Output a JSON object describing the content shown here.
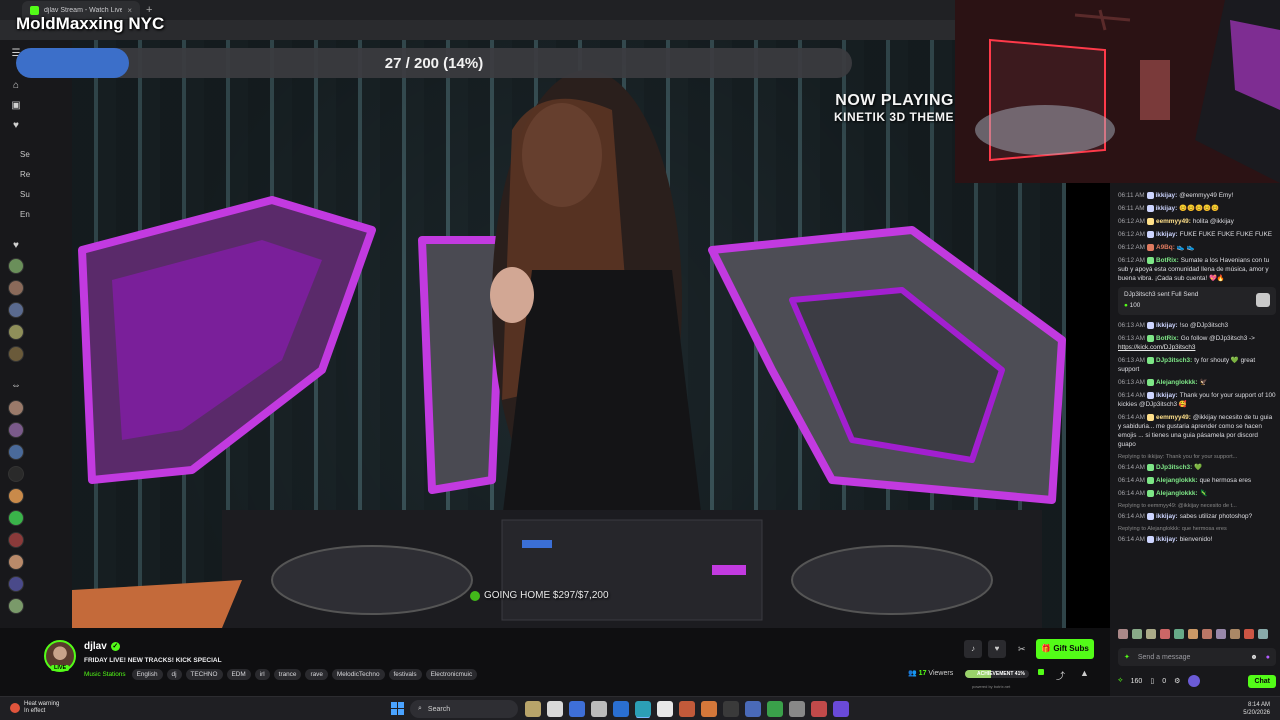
{
  "browser": {
    "tab_title": "djlav Stream - Watch Live on",
    "tab_close": "×",
    "new_tab": "+"
  },
  "overlay": {
    "channel_title": "MoldMaxxing NYC",
    "goal_text": "27 / 200 (14%)",
    "goal_progress": 0.135
  },
  "video": {
    "now_playing_label": "NOW PLAYING",
    "now_playing_track": "KINETIK 3D THEME",
    "sub_goal": "GOING HOME  $297/$7,200",
    "logo_color": "#a21fd0"
  },
  "sidebar": {
    "items": [
      "Se",
      "Re",
      "Su",
      "En"
    ],
    "avatar_colors": [
      "#6a8f5a",
      "#8a6a5a",
      "#5a6a8f",
      "#8f8f5a",
      "#6a5a3a",
      "#9a7a6a",
      "#7a5a8a",
      "#4a6a9a",
      "#2a2a2a",
      "#c98a4a",
      "#3ab34a",
      "#8a3a3a",
      "#b98a6a",
      "#4a4a8a",
      "#7a9a6a"
    ]
  },
  "chat": {
    "messages": [
      {
        "ts": "06:11 AM",
        "user": "ikkijay:",
        "color": "#cdd5ff",
        "text": "@eemmyy49 Emy!"
      },
      {
        "ts": "06:11 AM",
        "user": "ikkijay:",
        "color": "#cdd5ff",
        "text": "😊😊😊😊😊"
      },
      {
        "ts": "06:12 AM",
        "user": "eemmyy49:",
        "color": "#ffe08a",
        "text": "holita @ikkijay"
      },
      {
        "ts": "06:12 AM",
        "user": "ikkijay:",
        "color": "#cdd5ff",
        "text": "FUKE FUKE FUKE FUKE FUKE"
      },
      {
        "ts": "06:12 AM",
        "user": "A9Bq:",
        "color": "#e07a5f",
        "text": "👟 👟"
      },
      {
        "ts": "06:12 AM",
        "user": "BotRix:",
        "color": "#7ee787",
        "text": "Sumate a los Havenians con tu sub y apoyá esta comunidad llena de música, amor y buena vibra. ¡Cada sub cuenta! 💖🔥"
      }
    ],
    "gift": {
      "user": "DJp3itsch3",
      "text": "sent Full Send",
      "amount": "100"
    },
    "messages2": [
      {
        "ts": "06:13 AM",
        "user": "ikkijay:",
        "color": "#cdd5ff",
        "text": "!so @DJp3itsch3"
      },
      {
        "ts": "06:13 AM",
        "user": "BotRix:",
        "color": "#7ee787",
        "text": "Go follow @DJp3itsch3 -> ",
        "link": "https://kick.com/DJp3itsch3"
      },
      {
        "ts": "06:13 AM",
        "user": "DJp3itsch3:",
        "color": "#7ee787",
        "text": "ty for shouty 💚 great support"
      },
      {
        "ts": "06:13 AM",
        "user": "Alejanglokkk:",
        "color": "#7ee787",
        "text": "🦅"
      },
      {
        "ts": "06:14 AM",
        "user": "ikkijay:",
        "color": "#cdd5ff",
        "text": "Thank you for your support of 100 kickies @DJp3itsch3 🥰"
      },
      {
        "ts": "06:14 AM",
        "user": "eemmyy49:",
        "color": "#ffe08a",
        "text": "@ikkijay necesito de tu guia y sabiduria... me gustaria aprender como se hacen emojis ... si tienes una guia pásamela por discord guapo"
      }
    ],
    "reply1": "Replying to ikkijay: Thank you for your support...",
    "messages3": [
      {
        "ts": "06:14 AM",
        "user": "DJp3itsch3:",
        "color": "#7ee787",
        "text": "💚"
      },
      {
        "ts": "06:14 AM",
        "user": "Alejanglokkk:",
        "color": "#7ee787",
        "text": "que hermosa eres"
      },
      {
        "ts": "06:14 AM",
        "user": "Alejanglokkk:",
        "color": "#7ee787",
        "text": "🦎"
      }
    ],
    "reply2": "Replying to eemmyy49: @ikkijay necesito de t...",
    "messages4": [
      {
        "ts": "06:14 AM",
        "user": "ikkijay:",
        "color": "#cdd5ff",
        "text": "sabes utilizar photoshop?"
      }
    ],
    "reply3": "Replying to Alejanglokkk: que hermosa eres",
    "messages5": [
      {
        "ts": "06:14 AM",
        "user": "ikkijay:",
        "color": "#cdd5ff",
        "text": "bienvenido!"
      }
    ],
    "input_placeholder": "Send a message",
    "points": "160",
    "kicks": "0",
    "chat_button": "Chat"
  },
  "stream": {
    "channel": "djlav",
    "live_label": "LIVE",
    "title": "FRIDAY LIVE! NEW TRACKS! KICK SPECIAL",
    "category": "Music Stations",
    "tags": [
      "English",
      "dj",
      "TECHNO",
      "EDM",
      "irl",
      "trance",
      "rave",
      "MelodicTechno",
      "festivals",
      "Electronicmuic"
    ],
    "viewers_count": "17",
    "viewers_label": "Viewers",
    "hype_label": "ACHIEVEMENT",
    "hype_value": "41%",
    "hype_fraction": 0.41,
    "powered_by": "powered by botrix.net",
    "gift_button": "Gift Subs"
  },
  "taskbar": {
    "weather_line1": "Heat warning",
    "weather_line2": "In effect",
    "search_placeholder": "Search",
    "time": "8:14 AM",
    "date": "5/20/2026"
  }
}
